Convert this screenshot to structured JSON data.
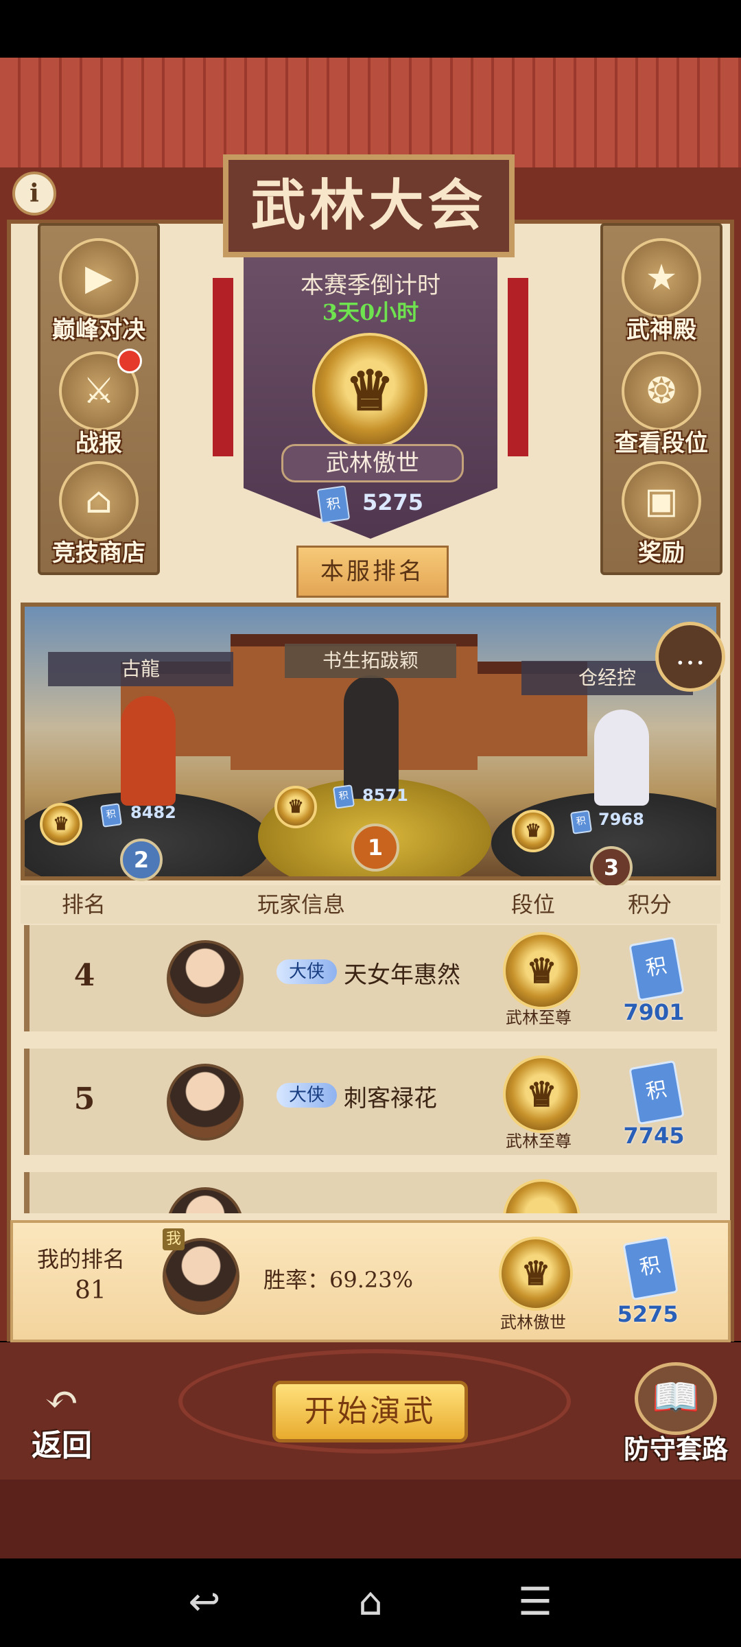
{
  "header": {
    "title": "武林大会"
  },
  "season": {
    "label": "本赛季倒计时",
    "countdown": "3天0小时",
    "tier": "武林傲世",
    "score": "5275"
  },
  "left_menu": [
    {
      "label": "巅峰对决",
      "icon": "play-icon"
    },
    {
      "label": "战报",
      "icon": "battle-report-icon",
      "has_notification": true
    },
    {
      "label": "竞技商店",
      "icon": "shop-icon"
    }
  ],
  "right_menu": [
    {
      "label": "武神殿",
      "icon": "temple-icon"
    },
    {
      "label": "查看段位",
      "icon": "dragon-icon"
    },
    {
      "label": "奖励",
      "icon": "chest-icon"
    }
  ],
  "server_rank_button": "本服排名",
  "podium": [
    {
      "place": "1",
      "name": "书生拓跋颖",
      "score": "8571"
    },
    {
      "place": "2",
      "name": "古龍",
      "score": "8482"
    },
    {
      "place": "3",
      "name": "仓经控",
      "score": "7968"
    }
  ],
  "table": {
    "headers": {
      "rank": "排名",
      "player": "玩家信息",
      "tier": "段位",
      "points": "积分"
    },
    "rows": [
      {
        "rank": "4",
        "title": "大侠",
        "name": "天女年惠然",
        "tier": "武林至尊",
        "points": "7901"
      },
      {
        "rank": "5",
        "title": "大侠",
        "name": "刺客禄花",
        "tier": "武林至尊",
        "points": "7745"
      }
    ]
  },
  "my_rank": {
    "label": "我的排名",
    "value": "81",
    "me_badge": "我",
    "win_rate": "胜率：69.23%",
    "tier": "武林傲世",
    "points": "5275"
  },
  "buttons": {
    "back": "返回",
    "start": "开始演武",
    "defense": "防守套路"
  },
  "score_chip": "积",
  "colors": {
    "countdown": "#6fe34f",
    "points": "#2a5fb8",
    "roof": "#b74e3e",
    "panel": "#f1e2c6"
  }
}
